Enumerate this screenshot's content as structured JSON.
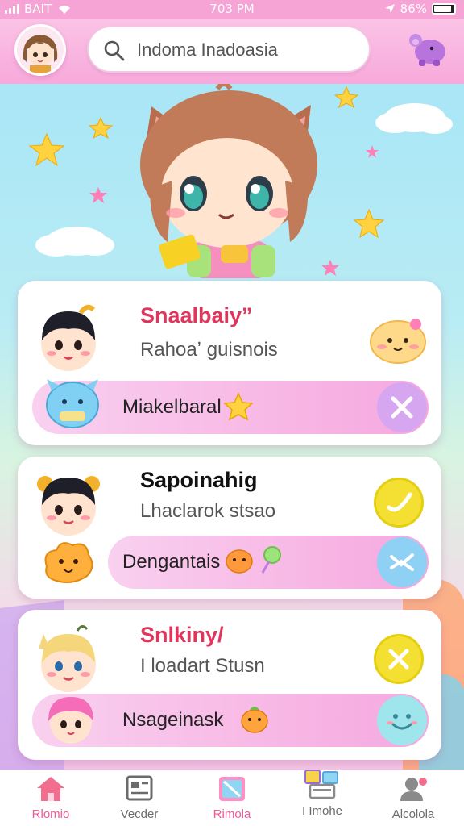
{
  "status_bar": {
    "carrier": "BAIT",
    "time": "703 PM",
    "battery": "86%",
    "battery_level": 0.86
  },
  "header": {
    "avatar": "girl-avatar",
    "search": {
      "value": "Indoma Inadoasia",
      "icon": "search-icon"
    },
    "right_icon": "purple-pet-icon"
  },
  "hero": {
    "character": "cat-ear-chibi-girl"
  },
  "cards": [
    {
      "title": "Snaalbaiy”",
      "subtitle": "Rahoaʼ guisnois",
      "title_color": "#e0365d",
      "action": "close",
      "pill": {
        "label": "Miakelbaral"
      }
    },
    {
      "title": "Sapoinahig",
      "subtitle": "Lhaclarok stsao",
      "title_color": "#111111",
      "action": "check",
      "pill": {
        "label": "Dengantais"
      }
    },
    {
      "title": "Snlkiny/",
      "subtitle": "I loadart Stusn",
      "title_color": "#e0365d",
      "action": "close",
      "pill": {
        "label": "Nsageinask"
      }
    }
  ],
  "tabs": [
    {
      "label": "Rlomio",
      "icon": "home-icon",
      "active": true
    },
    {
      "label": "Vecder",
      "icon": "board-icon",
      "active": false
    },
    {
      "label": "Rimola",
      "icon": "gallery-icon",
      "active": true
    },
    {
      "label": "I Imohe",
      "icon": "shop-icon",
      "active": false
    },
    {
      "label": "Alcolola",
      "icon": "profile-icon",
      "active": false
    }
  ],
  "colors": {
    "accent": "#f6a3d6",
    "active_tab": "#ef5a9a",
    "pill": "#f6a8df"
  }
}
